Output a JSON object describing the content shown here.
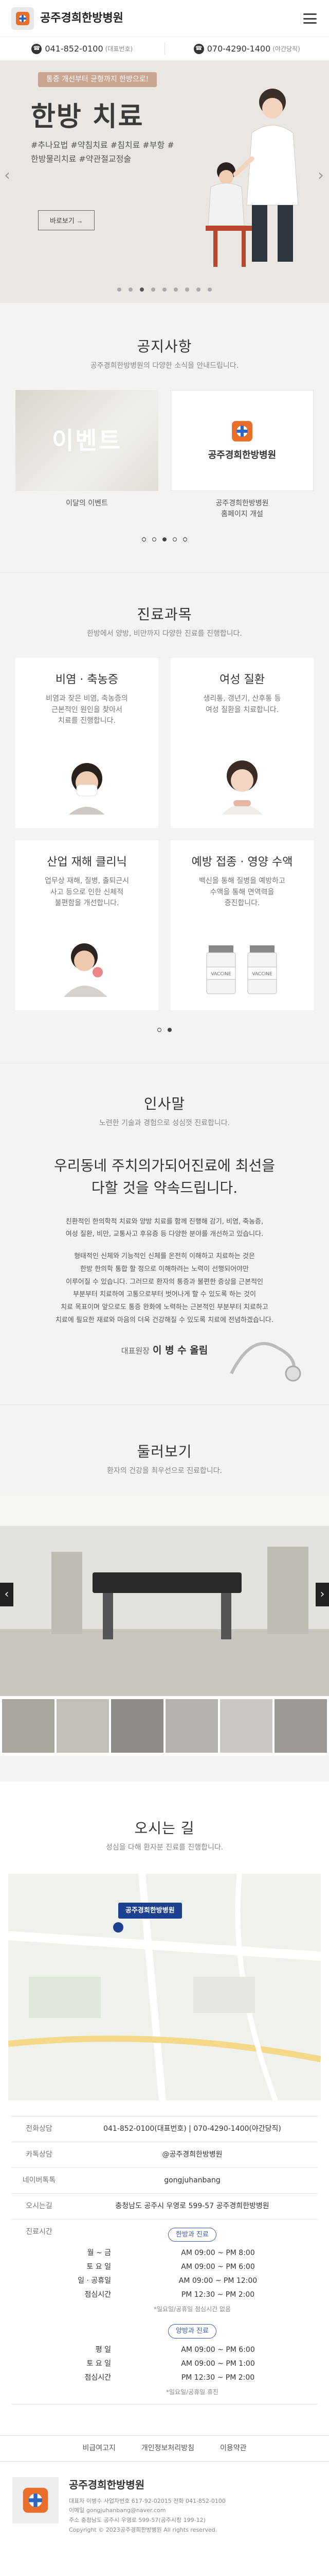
{
  "header": {
    "brand": "공주경희한방병원"
  },
  "phones": [
    {
      "number": "041-852-0100",
      "note": "(대표번호)"
    },
    {
      "number": "070-4290-1400",
      "note": "(야간당직)"
    }
  ],
  "hero": {
    "badge": "통증 개선부터 균형까지 한방으로!",
    "title": "한방 치료",
    "tags": "#추나요법 #약침치료 #침치료 #부항 #한방물리치료 #약관절교정술",
    "button": "바로보기 →",
    "prev": "‹",
    "next": "›",
    "dots": 9,
    "active_dot": 2
  },
  "notice": {
    "title": "공지사항",
    "subtitle": "공주경희한방병원의 다양한 소식을 안내드립니다.",
    "cards": [
      {
        "image_text": "이벤트",
        "title": "이달의 이벤트"
      },
      {
        "image_text": "공주경희한방병원",
        "title": "공주경희한방병원\n홈페이지 개설"
      }
    ],
    "dots": 5,
    "active_dot": 2
  },
  "dept": {
    "title": "진료과목",
    "subtitle": "한방에서 양방, 비만까지 다양한 진료를 진행합니다.",
    "cards": [
      {
        "name": "비염 · 축농증",
        "desc": "비염과 잦은 비염, 축농증의\n근본적인 원인을 찾아서\n치료를 진행합니다."
      },
      {
        "name": "여성 질환",
        "desc": "생리통, 갱년기, 산후통 등\n여성 질환을 치료합니다."
      },
      {
        "name": "산업 재해 클리닉",
        "desc": "업무상 재해, 질병, 출퇴근시\n사고 등으로 인한 신체적\n불편함을 개선합니다."
      },
      {
        "name": "예방 접종 · 영양 수액",
        "desc": "백신을 통해 질병을 예방하고\n수액을 통해 면역력을\n증진합니다."
      }
    ],
    "vaccine_labels": [
      "VACCINE",
      "VACCINE"
    ],
    "dots": 2,
    "active_dot": 1
  },
  "greeting": {
    "title": "인사말",
    "subtitle": "노련한 기술과 경험으로 성심껏 진료합니다.",
    "headline": "우리동네 주치의가되어진료에 최선을\n다할 것을 약속드립니다.",
    "body1": "친환적인 한의학적 치료와 양방 치료를 함께 진행해 감기, 비염, 축농증,\n여성 질환, 비만, 교통사고 후유증 등 다양한 분야를 개선하고 있습니다.",
    "body2": "형태적인 신체와 기능적인 신체를 온전히 이해하고 치료하는 것은\n한방 한의학 통합 할 정으로 이해하려는 노력이 선행되어야만\n이루어질 수 있습니다. 그러므로 환자의 통증과 불편한 증상을 근본적인\n부분부터 치료하여 고통으로부터 벗어나게 할 수 있도록 하는 것이\n치료 목표이며 앞으로도 통증 완화에 노력하는 근본적인 부분부터 치료하고\n치료에 필요한 재료와 마음의 더욱 건강해질 수 있도록 치료에 전념하겠습니다.",
    "sign_label": "대표원장",
    "sign_name": "이 병 수 올림"
  },
  "tour": {
    "title": "둘러보기",
    "subtitle": "환자의 건강을 최우선으로 진료합니다.",
    "prev": "‹",
    "next": "›",
    "thumbs": 6
  },
  "map": {
    "title": "오시는 길",
    "subtitle": "성심을 다해 환자분 진료를 진행합니다.",
    "marker": "공주경희한방병원"
  },
  "info": {
    "rows": [
      {
        "label": "전화상담",
        "value": "041-852-0100(대표번호) | 070-4290-1400(야간당직)"
      },
      {
        "label": "카톡상담",
        "value": "@공주경희한방병원"
      },
      {
        "label": "네이버톡톡",
        "value": "gongjuhanbang"
      },
      {
        "label": "오시는길",
        "value": "충청남도 공주시 우영로 599-57 공주경희한방병원"
      }
    ],
    "hours_label": "진료시간",
    "clinic_pill": "한방과 진료",
    "clinic": [
      {
        "day": "월 ~ 금",
        "time": "AM 09:00 ~ PM 8:00"
      },
      {
        "day": "토 요 일",
        "time": "AM 09:00 ~ PM 6:00"
      },
      {
        "day": "일 · 공휴일",
        "time": "AM 09:00 ~ PM 12:00"
      },
      {
        "day": "점심시간",
        "time": "PM 12:30 ~ PM 2:00"
      }
    ],
    "clinic_note": "*일요일/공휴일 점심시간 없음",
    "west_pill": "양방과 진료",
    "west": [
      {
        "day": "평 일",
        "time": "AM 09:00 ~ PM 6:00"
      },
      {
        "day": "토 요 일",
        "time": "AM 09:00 ~ PM 1:00"
      },
      {
        "day": "점심시간",
        "time": "PM 12:30 ~ PM 2:00"
      }
    ],
    "west_note": "*일요일/공휴일 휴진"
  },
  "footer": {
    "links": [
      "비급여고지",
      "개인정보처리방침",
      "이용약관"
    ],
    "name": "공주경희한방병원",
    "info": "대표자 이병수  사업자번호 617-92-02015  전화 041-852-0100\n이메일 gongjuhanbang@naver.com\n주소 충청남도 공주시 우영로 599-57(공주시청 199-12)\nCopyright © 2023공주경희한방병원 All rights reserved."
  },
  "colors": {
    "accent": "#c9a592",
    "bg_warm": "#f5f3f1",
    "map_blue": "#1c3f8f"
  }
}
